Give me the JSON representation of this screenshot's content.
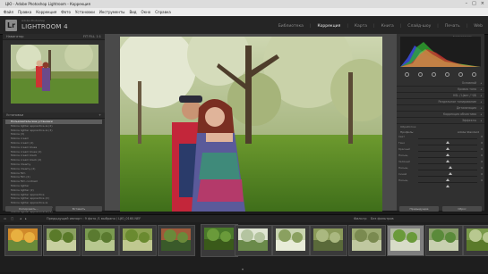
{
  "window": {
    "title": "ЦЮ - Adobe Photoshop Lightroom - Коррекция",
    "controls": [
      "–",
      "□",
      "×"
    ]
  },
  "menu": [
    "Файл",
    "Правка",
    "Коррекция",
    "Фото",
    "Установки",
    "Инструменты",
    "Вид",
    "Окно",
    "Справка"
  ],
  "header": {
    "logo": "Lr",
    "brand_sub": "Adobe Photoshop",
    "brand": "LIGHTROOM 4",
    "modules": [
      "Библиотека",
      "Коррекция",
      "Карта",
      "Книга",
      "Слайд-шоу",
      "Печать",
      "Web"
    ],
    "active_module": "Коррекция"
  },
  "left_panel": {
    "navigator_title": "Навигатор",
    "navigator_zoom": "FIT  FILL  1:1",
    "presets_title": "Установки",
    "presets": [
      "Пользовательские установки",
      "Molnia lighter apprentice-la (2)",
      "Molnia lighter apprentice-la (3)",
      "Molnia (3)",
      "Molnia cream",
      "Molnia cream (2)",
      "Molnia cream blues",
      "Molnia cream blues (2)",
      "Molnia cream black",
      "Molnia cream black (2)",
      "Molnia dreamy",
      "Molnia dreamy (2)",
      "Molnia film",
      "Molnia film (2)",
      "Molnia film contrast",
      "Molnia lighter",
      "Molnia lighter (2)",
      "Molnia lighter apprentice",
      "Molnia lighter apprentice (2)",
      "Molnia lighter apprentice-la",
      "Molnia lighter apprentice-la (4)",
      "Molnia lighter apprentice-la (5)"
    ],
    "selected_preset_index": 0,
    "copy_button": "Копировать...",
    "paste_button": "Вставить"
  },
  "right_panel": {
    "histogram_label": "Гистограмма",
    "sections": [
      "Основной",
      "Кривая тона",
      "HSL / Цвет / Ч/Б",
      "Раздельное тонирование",
      "Детализация",
      "Коррекция объектива",
      "Эффекты"
    ],
    "subhead": "Обработка:",
    "profile_label": "Профиль:",
    "profile_value": "Adobe Standard",
    "sliders": [
      {
        "label": "Свет",
        "value": "0",
        "level": 0.5
      },
      {
        "label": "Тени",
        "value": "0",
        "level": 0.5
      },
      {
        "label": "Красный",
        "value": "0",
        "level": 0.5
      },
      {
        "label": "Насыщ.",
        "value": "0",
        "level": 0.5
      },
      {
        "label": "Зелёный",
        "value": "0",
        "level": 0.55
      },
      {
        "label": "Насыщ.",
        "value": "0",
        "level": 0.55
      },
      {
        "label": "Синий",
        "value": "0",
        "level": 0.5
      },
      {
        "label": "Насыщ.",
        "value": "0",
        "level": 0.5
      }
    ],
    "prev_button": "Предыдущие",
    "reset_button": "Сброс"
  },
  "toolbar": {
    "source": "Предыдущий импорт : 9 фото /1 выбрано / ЦЮ_0160.NEF",
    "filter_label": "Фильтр:",
    "filter_value": "Без фильтров"
  },
  "filmstrip": {
    "selected_index": 10
  }
}
